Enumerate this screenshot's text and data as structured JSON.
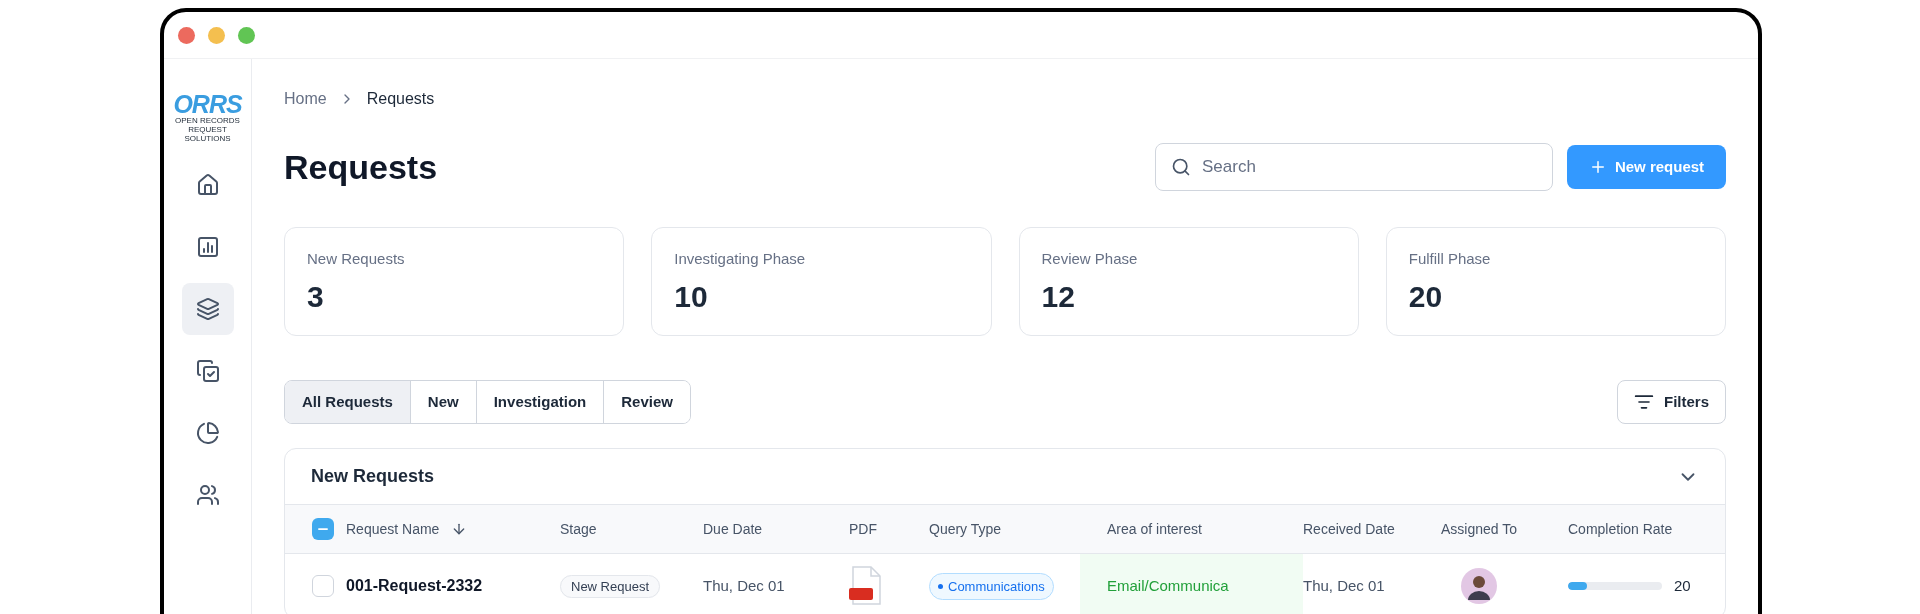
{
  "logo": {
    "name": "ORRS",
    "tagline": "OPEN RECORDS REQUEST SOLUTIONS"
  },
  "sidebar": {
    "items": [
      {
        "selected": false
      },
      {
        "selected": false
      },
      {
        "selected": true
      },
      {
        "selected": false
      },
      {
        "selected": false
      },
      {
        "selected": false
      }
    ]
  },
  "breadcrumb": [
    "Home",
    "Requests"
  ],
  "title": "Requests",
  "search": {
    "placeholder": "Search"
  },
  "new_button": "New request",
  "stats": [
    {
      "label": "New Requests",
      "value": "3"
    },
    {
      "label": "Investigating Phase",
      "value": "10"
    },
    {
      "label": "Review Phase",
      "value": "12"
    },
    {
      "label": "Fulfill Phase",
      "value": "20"
    }
  ],
  "tabs": [
    {
      "label": "All Requests",
      "selected": true
    },
    {
      "label": "New",
      "selected": false
    },
    {
      "label": "Investigation",
      "selected": false
    },
    {
      "label": "Review",
      "selected": false
    }
  ],
  "filters_button": "Filters",
  "table": {
    "title": "New Requests",
    "expanded": true,
    "select_all": {
      "checked": true,
      "indeterminate": true
    },
    "columns": [
      {
        "label": "Request Name",
        "sorted": true
      },
      {
        "label": "Stage",
        "sorted": false
      },
      {
        "label": "Due Date",
        "sorted": false
      },
      {
        "label": "PDF",
        "sorted": false
      },
      {
        "label": "Query Type",
        "sorted": false
      },
      {
        "label": "Area of interest",
        "sorted": false
      },
      {
        "label": "Received Date",
        "sorted": false
      },
      {
        "label": "Assigned To",
        "sorted": false
      },
      {
        "label": "Completion Rate",
        "sorted": false
      }
    ],
    "rows": [
      {
        "checked": false,
        "name": "001-Request-2332",
        "stage": "New Request",
        "due": "Thu, Dec 01",
        "query": "Communications",
        "area": "Email/Communica",
        "area_highlighted": true,
        "received": "Thu, Dec 01",
        "level": 0.2,
        "rate": "20"
      }
    ]
  }
}
